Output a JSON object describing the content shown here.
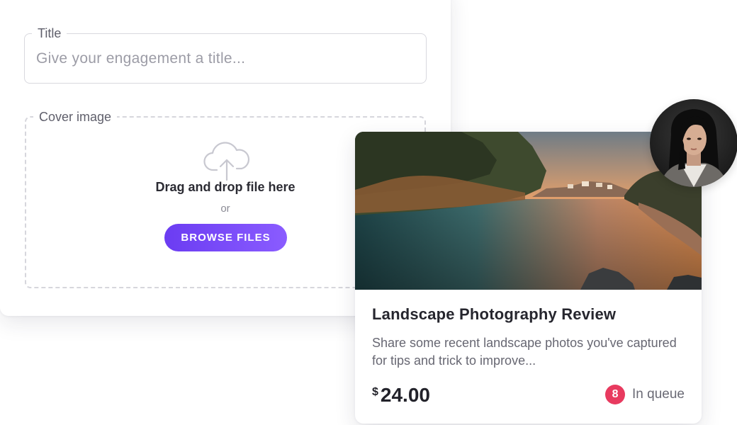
{
  "form": {
    "title_field": {
      "label": "Title",
      "placeholder": "Give your engagement a title...",
      "value": ""
    },
    "cover_image": {
      "label": "Cover image",
      "icon": "cloud-upload-icon",
      "drop_text": "Drag and drop file here",
      "or_text": "or",
      "browse_label": "BROWSE FILES"
    }
  },
  "card": {
    "image": "landscape-lake-sunset-photo",
    "title": "Landscape Photography Review",
    "description": "Share some recent landscape photos you've captured for tips and trick to improve...",
    "price_currency": "$",
    "price_amount": "24.00",
    "queue_count": "8",
    "queue_label": "In queue"
  },
  "avatar": {
    "icon": "user-avatar-photo"
  },
  "colors": {
    "accent_start": "#6b3cf2",
    "accent_end": "#8a5cff",
    "queue_badge": "#e83a5f",
    "text_dark": "#26262e",
    "text_muted": "#676772"
  }
}
